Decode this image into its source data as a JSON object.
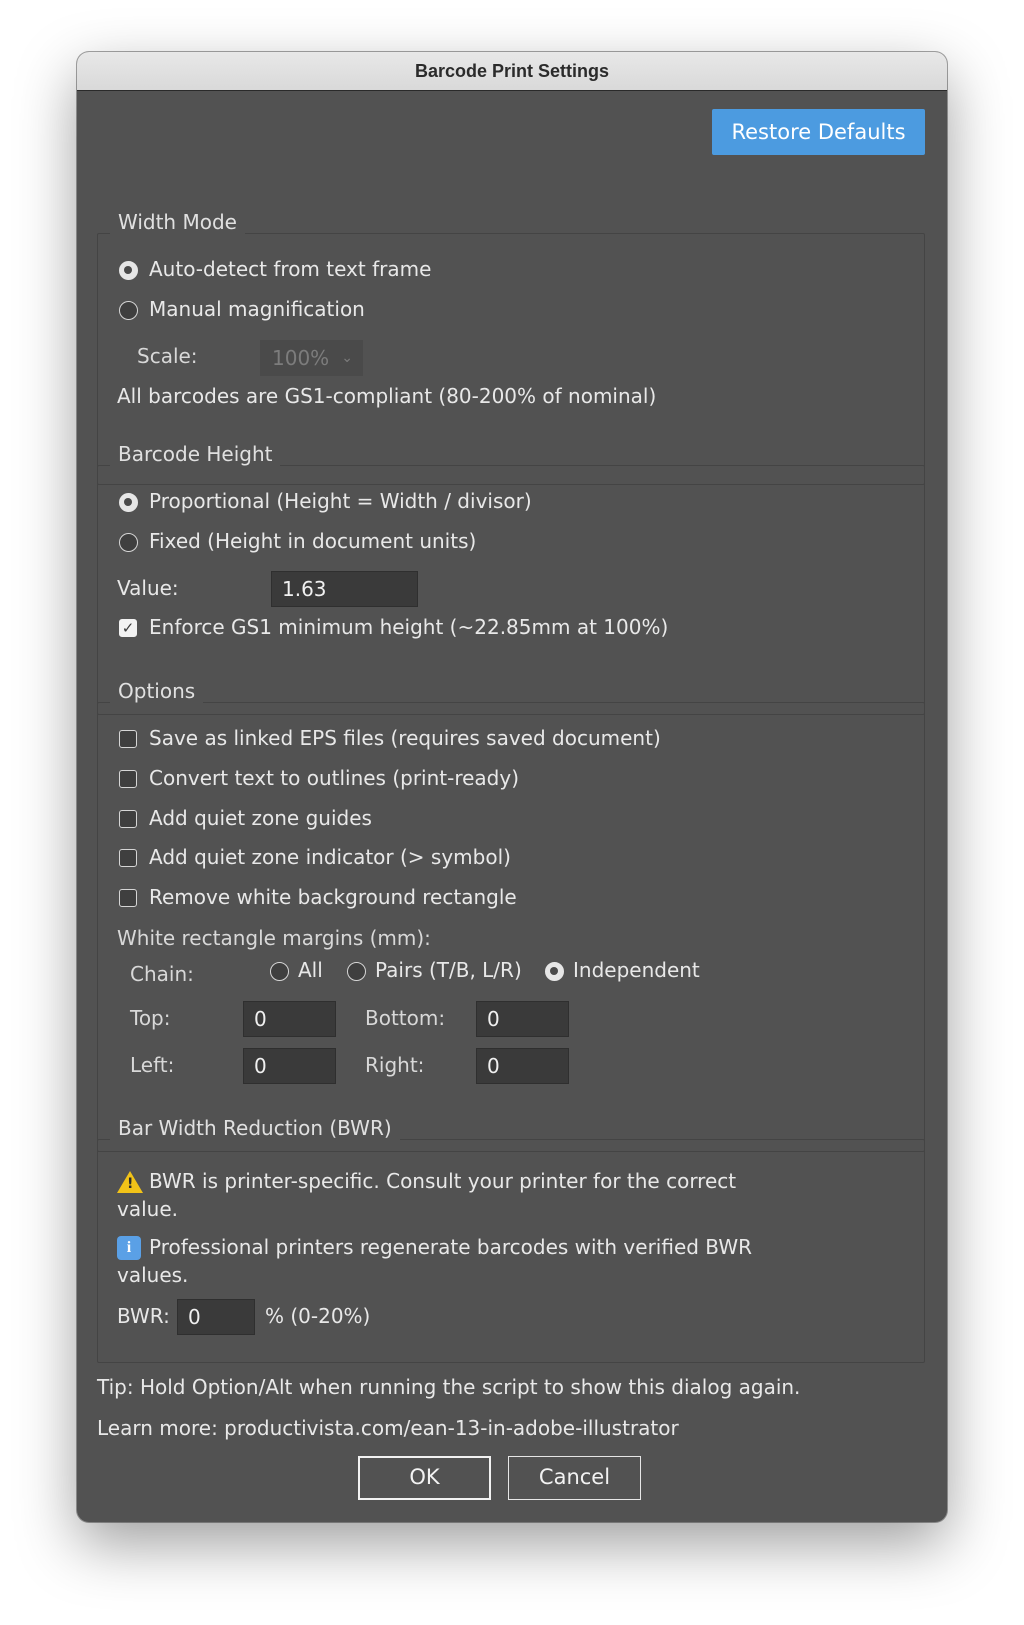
{
  "window": {
    "title": "Barcode Print Settings"
  },
  "restore_defaults_label": "Restore Defaults",
  "width_mode": {
    "legend": "Width Mode",
    "auto_label": "Auto-detect from text frame",
    "manual_label": "Manual magnification",
    "selected": "auto",
    "scale_label": "Scale:",
    "scale_value": "100%",
    "note": "All barcodes are GS1-compliant (80-200% of nominal)"
  },
  "barcode_height": {
    "legend": "Barcode Height",
    "proportional_label": "Proportional (Height = Width / divisor)",
    "fixed_label": "Fixed (Height in document units)",
    "selected": "proportional",
    "value_label": "Value:",
    "value": "1.63",
    "enforce_label": "Enforce GS1 minimum height (~22.85mm at 100%)",
    "enforce_checked": true
  },
  "options": {
    "legend": "Options",
    "checkboxes": [
      {
        "label": "Save as linked EPS files (requires saved document)",
        "checked": false
      },
      {
        "label": "Convert text to outlines (print-ready)",
        "checked": false
      },
      {
        "label": "Add quiet zone guides",
        "checked": false
      },
      {
        "label": "Add quiet zone indicator (> symbol)",
        "checked": false
      },
      {
        "label": "Remove white background rectangle",
        "checked": false
      }
    ],
    "margins_label": "White rectangle margins (mm):",
    "chain_label": "Chain:",
    "chain_options": [
      "All",
      "Pairs (T/B, L/R)",
      "Independent"
    ],
    "chain_selected": "Independent",
    "top_label": "Top:",
    "top_value": "0",
    "bottom_label": "Bottom:",
    "bottom_value": "0",
    "left_label": "Left:",
    "left_value": "0",
    "right_label": "Right:",
    "right_value": "0"
  },
  "bwr": {
    "legend": "Bar Width Reduction (BWR)",
    "warning_line1": "BWR is printer-specific. Consult your printer for the correct",
    "warning_line2": "value.",
    "info_line1": "Professional printers regenerate barcodes with verified BWR",
    "info_line2": "values.",
    "bwr_label": "BWR:",
    "bwr_value": "0",
    "bwr_range": "% (0-20%)"
  },
  "tip": "Tip: Hold Option/Alt when running the script to show this dialog again.",
  "learn_more": "Learn more: productivista.com/ean-13-in-adobe-illustrator",
  "ok_label": "OK",
  "cancel_label": "Cancel",
  "icons": {
    "warning": "warning-icon",
    "info": "info-icon",
    "checkmark": "checkmark-icon",
    "chevron": "chevron-down-icon"
  },
  "colors": {
    "dialog_bg": "#525252",
    "accent": "#4c9be0",
    "warning": "#f2c318",
    "info": "#5aa0e6"
  }
}
